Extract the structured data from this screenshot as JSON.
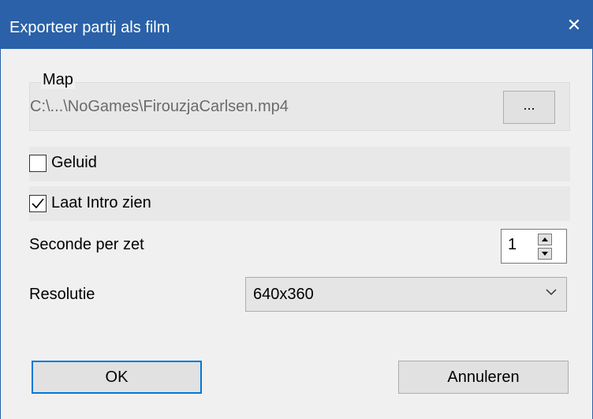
{
  "window": {
    "title": "Exporteer partij als film",
    "close_glyph": "✕"
  },
  "folder": {
    "group_label": "Map",
    "path": "C:\\...\\NoGames\\FirouzjaCarlsen.mp4",
    "browse_label": "..."
  },
  "options": {
    "sound_label": "Geluid",
    "sound_checked": false,
    "intro_label": "Laat Intro zien",
    "intro_checked": true
  },
  "seconds": {
    "label": "Seconde per zet",
    "value": "1"
  },
  "resolution": {
    "label": "Resolutie",
    "selected": "640x360"
  },
  "buttons": {
    "ok_label": "OK",
    "cancel_label": "Annuleren"
  }
}
